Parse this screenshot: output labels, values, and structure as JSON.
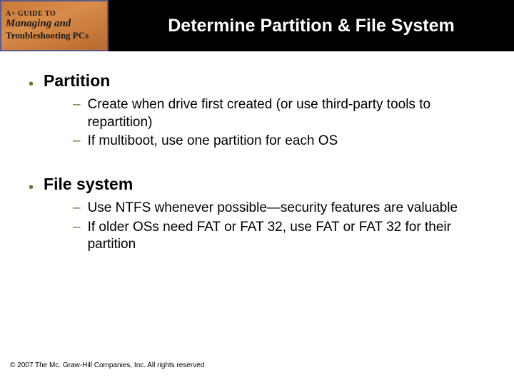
{
  "logo": {
    "line1": "A+ GUIDE TO",
    "line2": "Managing and",
    "line3": "Troubleshooting PCs"
  },
  "title": "Determine Partition & File System",
  "sections": [
    {
      "heading": "Partition",
      "items": [
        "Create when drive first created (or use third-party tools to repartition)",
        "If multiboot, use one partition for each OS"
      ]
    },
    {
      "heading": "File system",
      "items": [
        "Use NTFS whenever possible—security features are valuable",
        "If older OSs need FAT or FAT 32, use FAT or FAT 32 for their partition"
      ]
    }
  ],
  "footer": "© 2007 The Mc. Graw-Hill Companies, Inc. All rights reserved"
}
